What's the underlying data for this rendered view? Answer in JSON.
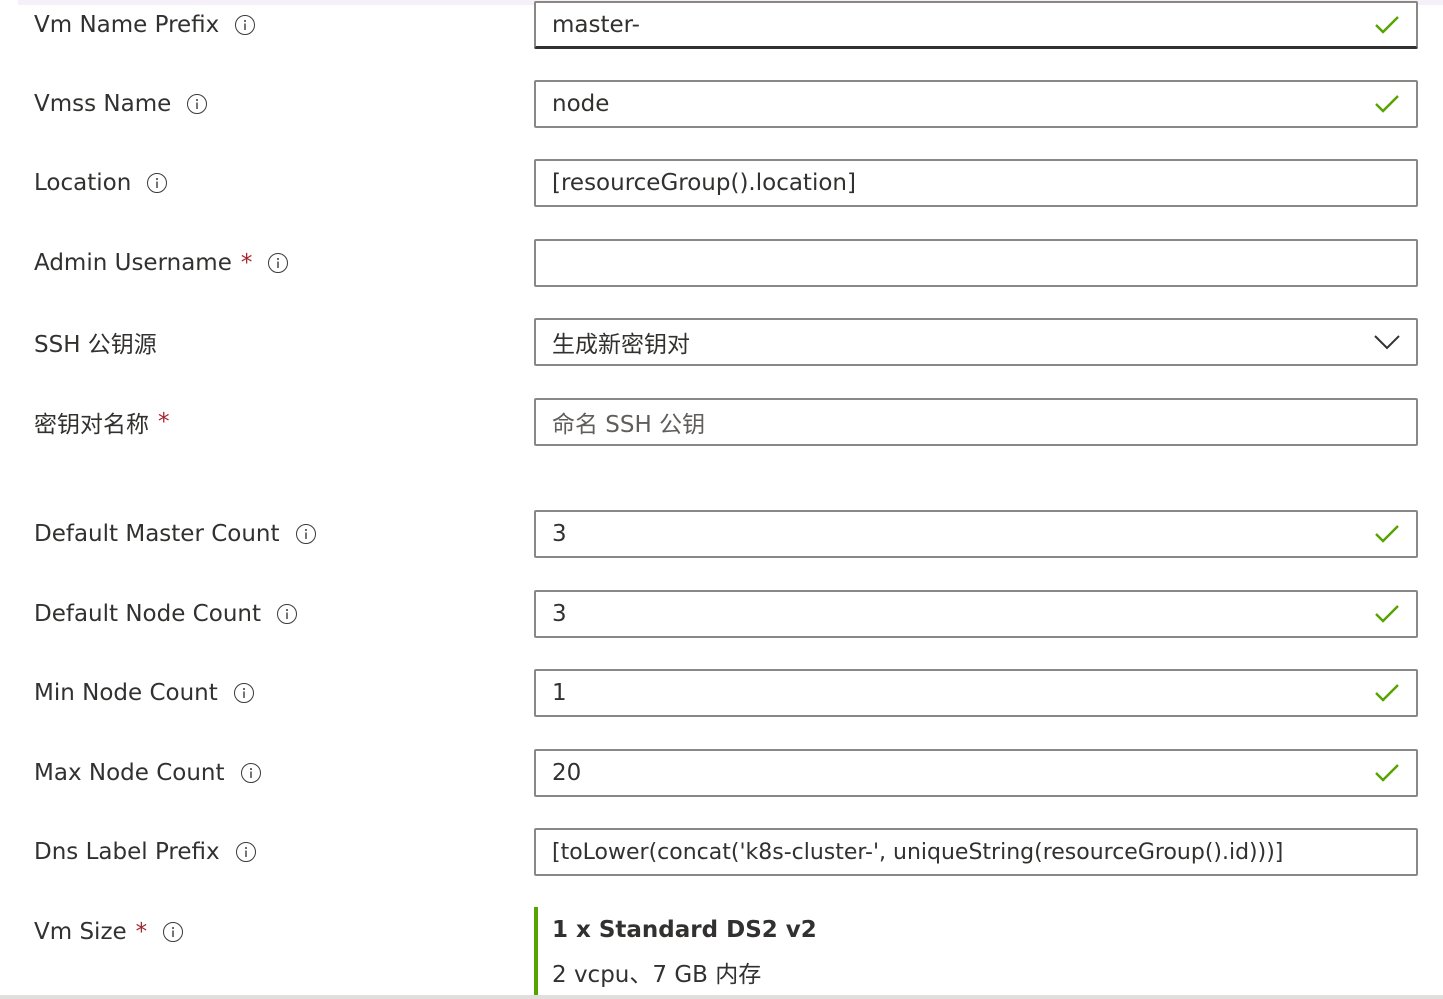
{
  "rows": [
    {
      "label": "Vm Name Prefix",
      "value": "master-"
    },
    {
      "label": "Vmss Name",
      "value": "node"
    },
    {
      "label": "Location",
      "value": "[resourceGroup().location]"
    },
    {
      "label": "Admin Username",
      "value": ""
    },
    {
      "label": "SSH 公钥源",
      "value": "生成新密钥对"
    },
    {
      "label": "密钥对名称",
      "placeholder": "命名 SSH 公钥"
    },
    {
      "label": "Default Master Count",
      "value": "3"
    },
    {
      "label": "Default Node Count",
      "value": "3"
    },
    {
      "label": "Min Node Count",
      "value": "1"
    },
    {
      "label": "Max Node Count",
      "value": "20"
    },
    {
      "label": "Dns Label Prefix",
      "value": "[toLower(concat('k8s-cluster-', uniqueString(resourceGroup().id)))]"
    },
    {
      "label": "Vm Size"
    }
  ],
  "required_marker": "*",
  "vm_size": {
    "name": "1 x Standard DS2 v2",
    "specs": "2 vcpu、7 GB 内存"
  },
  "colors": {
    "valid": "#57a300",
    "required": "#a4262c",
    "border": "#8a8886",
    "text": "#323130"
  }
}
